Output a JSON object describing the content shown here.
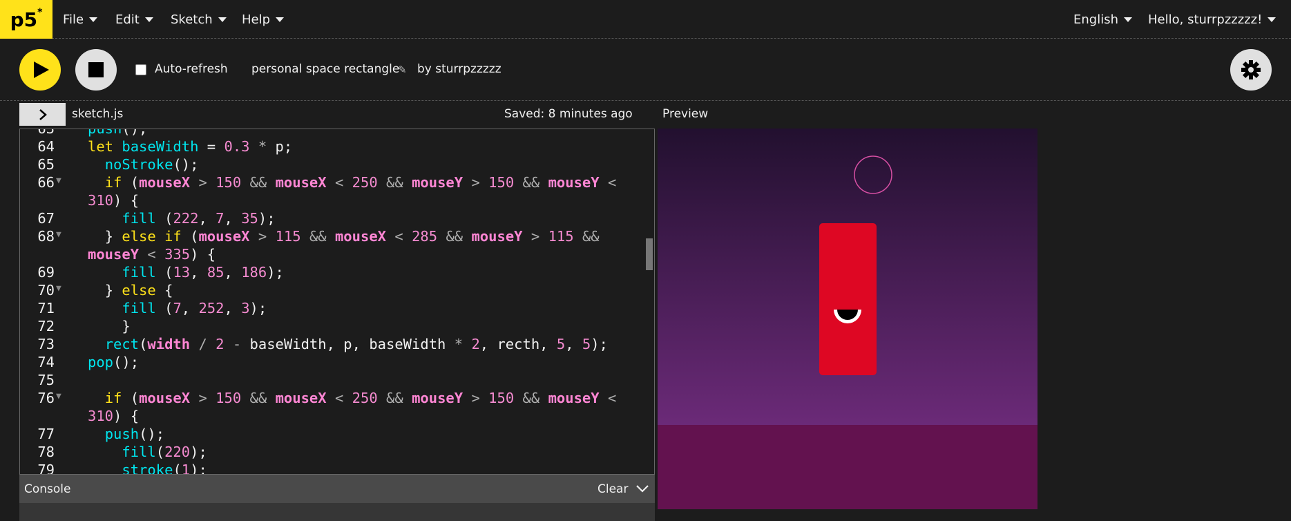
{
  "nav": {
    "logo": "p5",
    "logo_sup": "*",
    "menus": [
      "File",
      "Edit",
      "Sketch",
      "Help"
    ],
    "language": "English",
    "user": "Hello, sturrpzzzzz!"
  },
  "toolbar": {
    "auto_refresh": "Auto-refresh",
    "sketch_name": "personal space rectangle",
    "by_user": "by sturrpzzzzz"
  },
  "editor": {
    "file_name": "sketch.js",
    "saved": "Saved: 8 minutes ago"
  },
  "preview": {
    "label": "Preview",
    "colors": {
      "sky_top": "#22102f",
      "sky_bottom": "#6b2a78",
      "ground": "#63124f",
      "rect": "#de0723",
      "circle": "#d64fa3"
    }
  },
  "console": {
    "label": "Console",
    "clear": "Clear"
  },
  "colors": {
    "accent": "#ffe21a",
    "bg": "#1c1c1c"
  }
}
